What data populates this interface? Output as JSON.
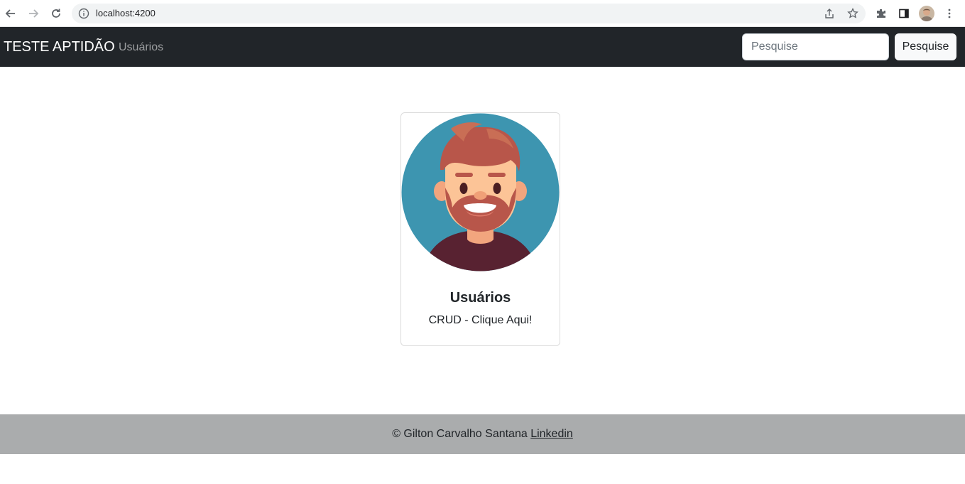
{
  "browser": {
    "url": "localhost:4200"
  },
  "navbar": {
    "brand": "TESTE APTIDÃO",
    "nav_link": "Usuários",
    "search_placeholder": "Pesquise",
    "search_button": "Pesquise",
    "bg_color": "#212529"
  },
  "card": {
    "title": "Usuários",
    "text": "CRUD - Clique Aqui!",
    "image_icon": "bearded-man-avatar"
  },
  "footer": {
    "copyright": "© Gilton Carvalho Santana",
    "link_text": "Linkedin",
    "bg_color": "#aaacad"
  }
}
